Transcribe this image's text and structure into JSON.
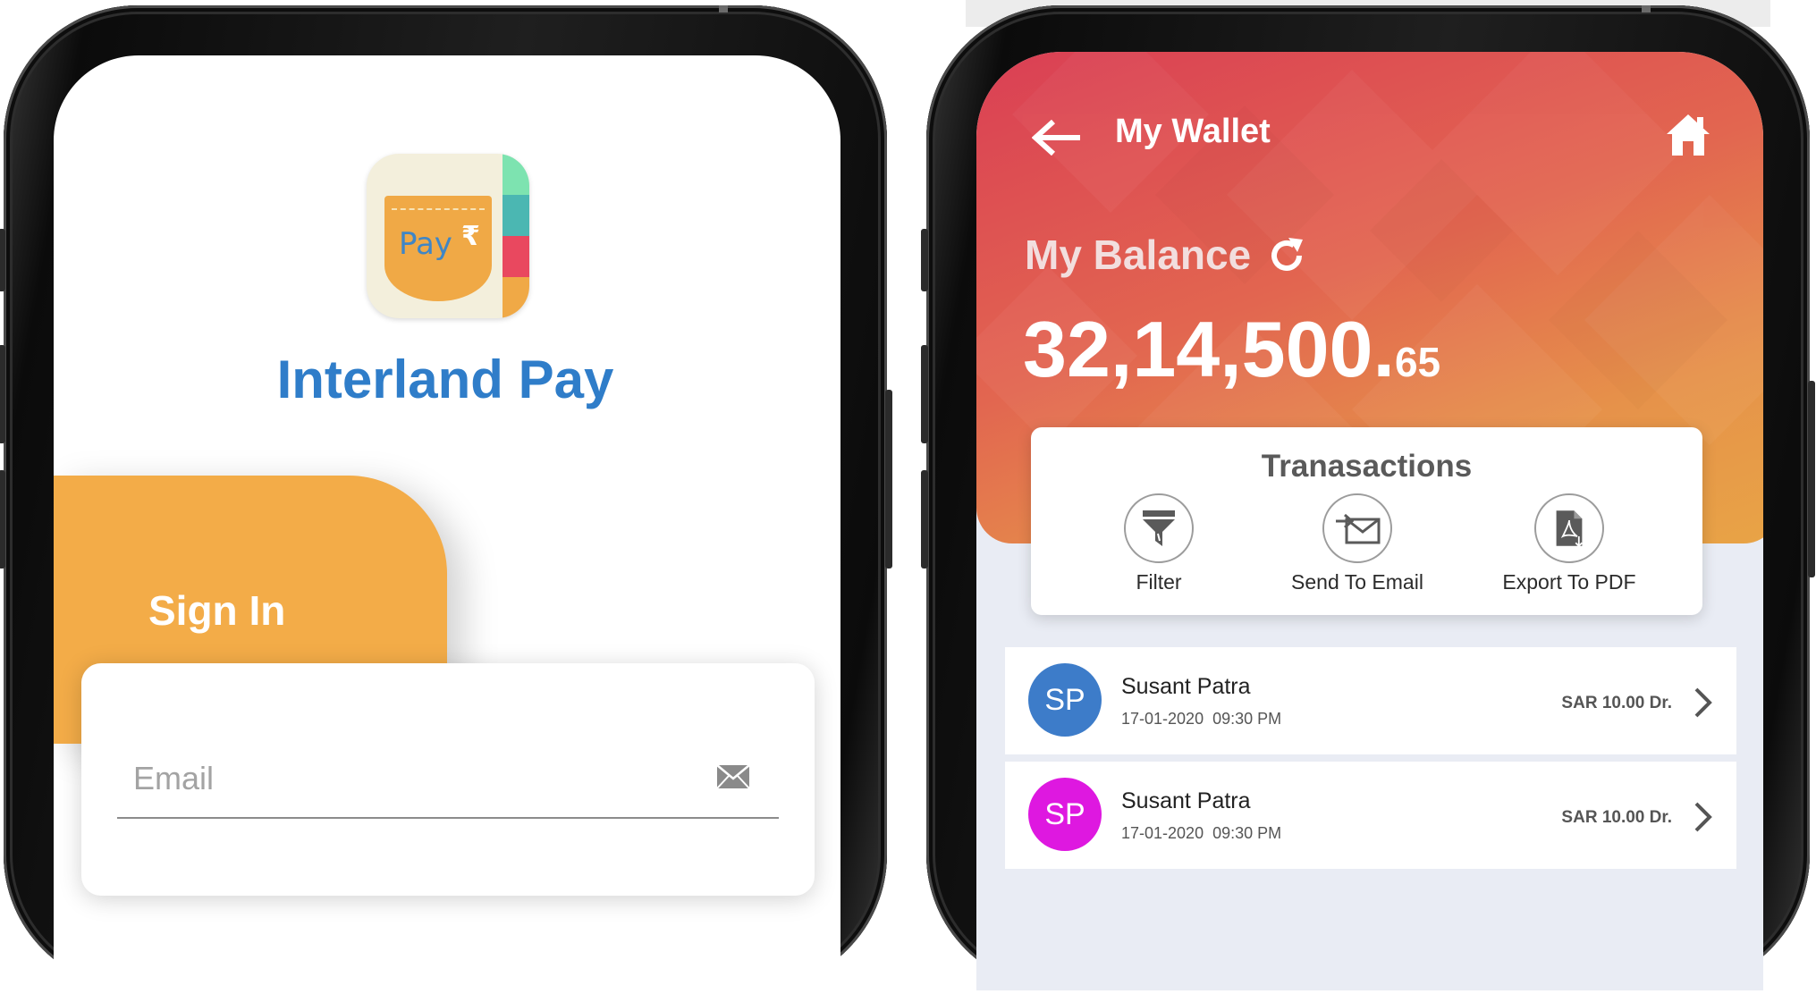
{
  "login_screen": {
    "app_icon": {
      "name": "wallet-pocket-icon",
      "pocket_text": "Pay",
      "symbol": "₹"
    },
    "brand_name": "Interland Pay",
    "signin_title": "Sign In",
    "email_field": {
      "label": "Email",
      "icon": "mail-icon"
    }
  },
  "wallet_screen": {
    "header": {
      "back_icon": "arrow-left-icon",
      "title": "My Wallet",
      "home_icon": "home-icon"
    },
    "balance": {
      "label": "My Balance",
      "refresh_icon": "refresh-icon",
      "amount_main": "32,14,500.",
      "amount_decimal": "65"
    },
    "transactions_card": {
      "title": "Tranasactions",
      "actions": [
        {
          "label": "Filter",
          "icon": "filter-icon"
        },
        {
          "label": "Send To Email",
          "icon": "send-mail-icon"
        },
        {
          "label": "Export To PDF",
          "icon": "pdf-file-icon"
        }
      ]
    },
    "transactions": [
      {
        "initials": "SP",
        "name": "Susant Patra",
        "date": "17-01-2020  09:30 PM",
        "amount": "SAR 10.00 Dr.",
        "avatar_color": "#3d7cc9"
      },
      {
        "initials": "SP",
        "name": "Susant Patra",
        "date": "17-01-2020  09:30 PM",
        "amount": "SAR 10.00 Dr.",
        "avatar_color": "#de18e0"
      }
    ]
  },
  "colors": {
    "brand_blue": "#2f7dc9",
    "signin_orange": "#f3ac48",
    "header_gradient_start": "#da3f54",
    "header_gradient_end": "#e8a446"
  }
}
